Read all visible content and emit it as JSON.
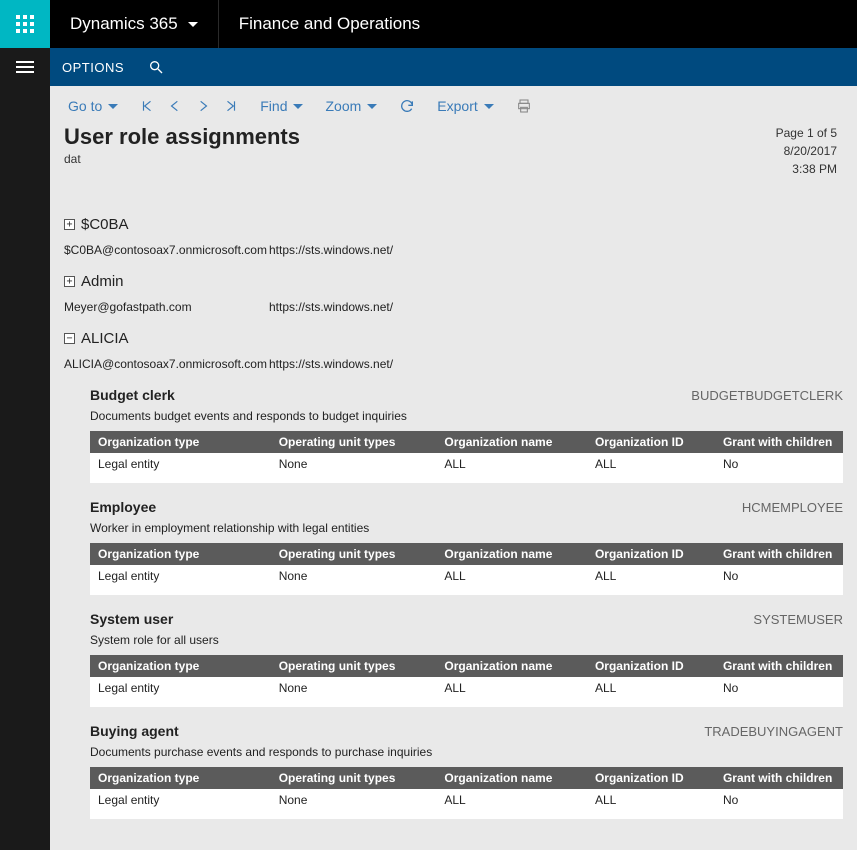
{
  "top": {
    "product": "Dynamics 365",
    "module": "Finance and Operations"
  },
  "options": {
    "label": "OPTIONS"
  },
  "toolbar": {
    "goto": "Go to",
    "find": "Find",
    "zoom": "Zoom",
    "export": "Export"
  },
  "report": {
    "title": "User role assignments",
    "subtitle": "dat",
    "page_info": "Page 1 of 5",
    "date": "8/20/2017",
    "time": "3:38 PM"
  },
  "table_headers": {
    "org_type": "Organization type",
    "op_unit": "Operating unit types",
    "org_name": "Organization name",
    "org_id": "Organization ID",
    "grant": "Grant with children"
  },
  "users": [
    {
      "expander": "+",
      "name": "$C0BA",
      "email": "$C0BA@contosoax7.onmicrosoft.com",
      "provider": "https://sts.windows.net/",
      "roles": []
    },
    {
      "expander": "+",
      "name": "Admin",
      "email": "Meyer@gofastpath.com",
      "provider": "https://sts.windows.net/",
      "roles": []
    },
    {
      "expander": "−",
      "name": "ALICIA",
      "email": "ALICIA@contosoax7.onmicrosoft.com",
      "provider": "https://sts.windows.net/",
      "roles": [
        {
          "title": "Budget clerk",
          "code": "BUDGETBUDGETCLERK",
          "desc": "Documents budget events and responds to budget inquiries",
          "rows": [
            {
              "org_type": "Legal entity",
              "op_unit": "None",
              "org_name": "ALL",
              "org_id": "ALL",
              "grant": "No"
            }
          ]
        },
        {
          "title": "Employee",
          "code": "HCMEMPLOYEE",
          "desc": "Worker in employment relationship with legal entities",
          "rows": [
            {
              "org_type": "Legal entity",
              "op_unit": "None",
              "org_name": "ALL",
              "org_id": "ALL",
              "grant": "No"
            }
          ]
        },
        {
          "title": "System user",
          "code": "SYSTEMUSER",
          "desc": "System role for all users",
          "rows": [
            {
              "org_type": "Legal entity",
              "op_unit": "None",
              "org_name": "ALL",
              "org_id": "ALL",
              "grant": "No"
            }
          ]
        },
        {
          "title": "Buying agent",
          "code": "TRADEBUYINGAGENT",
          "desc": "Documents purchase events and responds to purchase inquiries",
          "rows": [
            {
              "org_type": "Legal entity",
              "op_unit": "None",
              "org_name": "ALL",
              "org_id": "ALL",
              "grant": "No"
            }
          ]
        }
      ]
    }
  ]
}
